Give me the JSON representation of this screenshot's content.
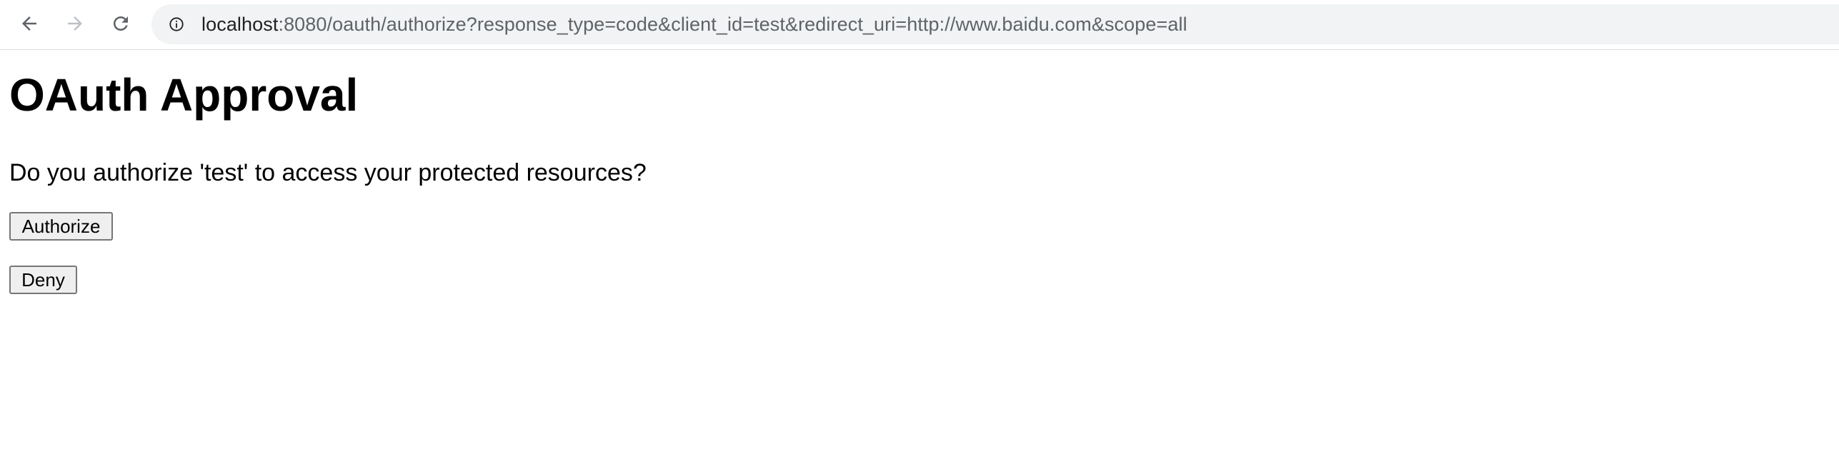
{
  "browser": {
    "url_host": "localhost",
    "url_rest": ":8080/oauth/authorize?response_type=code&client_id=test&redirect_uri=http://www.baidu.com&scope=all",
    "nav_icons": [
      "arrow-back-icon",
      "arrow-forward-icon",
      "reload-icon",
      "info-icon"
    ]
  },
  "page": {
    "title": "OAuth Approval",
    "question": "Do you authorize 'test' to access your protected resources?",
    "authorize_label": "Authorize",
    "deny_label": "Deny"
  },
  "colors": {
    "toolbar_icon": "#5f6368",
    "toolbar_icon_disabled": "#bdc1c6",
    "omnibox_bg": "#f1f3f4",
    "button_bg": "#efefef",
    "button_border": "#767676"
  }
}
